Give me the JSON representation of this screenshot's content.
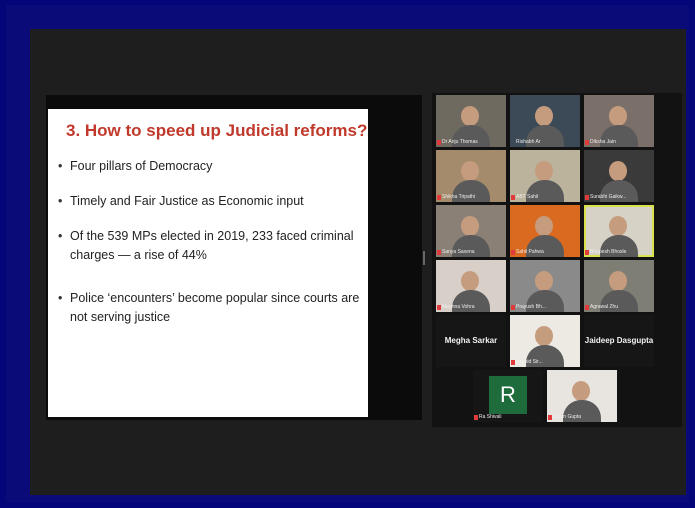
{
  "slide": {
    "title": "3. How to speed up Judicial reforms?",
    "bullets": [
      "Four pillars of Democracy",
      "Timely and Fair Justice as Economic input",
      "Of the 539 MPs elected in 2019, 233 faced criminal charges — a rise of 44%",
      "Police ‘encounters’ become popular since courts are not serving justice"
    ]
  },
  "participants": [
    {
      "name": "Dr Anju Thomas",
      "bg": "#6e6a5f"
    },
    {
      "name": "Rishabh Ar",
      "bg": "#3c4a57"
    },
    {
      "name": "Diksha Jain",
      "bg": "#7b6f6a"
    },
    {
      "name": "Shikha Tripathi",
      "bg": "#a38b6b"
    },
    {
      "name": "ABT Sahil",
      "bg": "#bcb39c"
    },
    {
      "name": "Surabhi Gaikw...",
      "bg": "#3a3a3a"
    },
    {
      "name": "Sanya Saxena",
      "bg": "#8a8076"
    },
    {
      "name": "Sahil Pahwa",
      "bg": "#d96a1f"
    },
    {
      "name": "Bhupesh Bhosle",
      "bg": "#d7d2c6"
    },
    {
      "name": "Meghna Vohra",
      "bg": "#d8d0c8"
    },
    {
      "name": "Prayush Bh...",
      "bg": "#8a8a8a"
    },
    {
      "name": "Agrawal Zhu",
      "bg": "#7e7e74"
    },
    {
      "name": "Megha Sarkar",
      "bg": "#161616"
    },
    {
      "name": "Sahsid Sir...",
      "bg": "#ede9e3"
    },
    {
      "name": "Jaideep Dasgupta",
      "bg": "#161616"
    },
    {
      "name": "Ra Shivali",
      "bg": "#161616",
      "initial": "R"
    },
    {
      "name": "Aryan Gupta",
      "bg": "#e8e4e0"
    }
  ],
  "colors": {
    "border": "#05057a",
    "slide_title": "#c0392b",
    "active_speaker": "#d9e24b",
    "avatar_bg": "#1e6b3c"
  }
}
